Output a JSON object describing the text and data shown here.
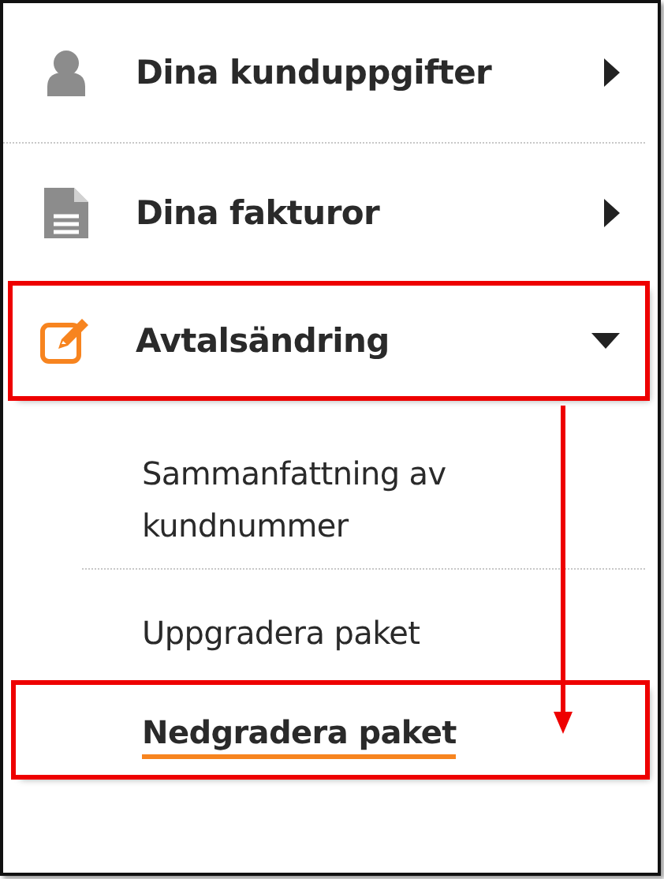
{
  "menu": {
    "items": [
      {
        "label": "Dina kunduppgifter",
        "expanded": false,
        "annotated": false
      },
      {
        "label": "Dina fakturor",
        "expanded": false,
        "annotated": false
      },
      {
        "label": "Avtalsändring",
        "expanded": true,
        "annotated": true,
        "children": [
          {
            "label": "Sammanfattning av kundnummer",
            "selected": false,
            "annotated": false
          },
          {
            "label": "Uppgradera paket",
            "selected": false,
            "annotated": false
          },
          {
            "label": "Nedgradera paket",
            "selected": true,
            "annotated": true
          }
        ]
      }
    ]
  }
}
